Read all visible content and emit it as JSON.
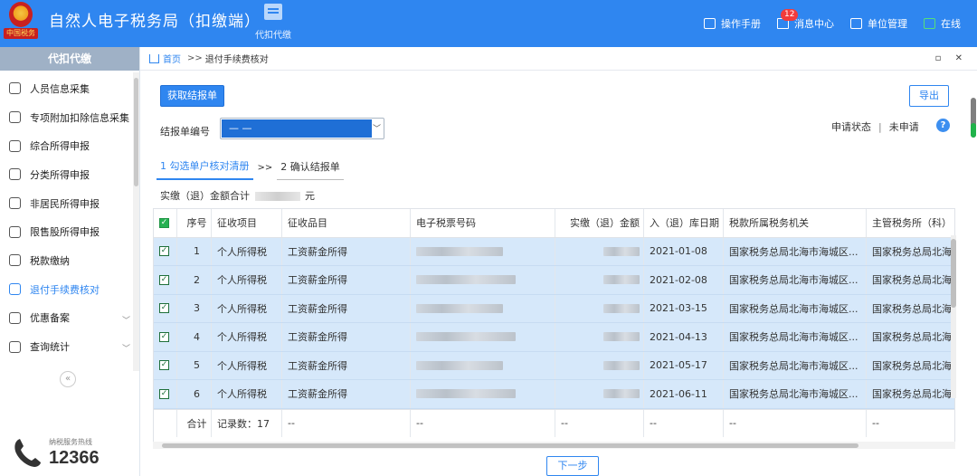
{
  "header": {
    "logo_text": "中国税务",
    "title": "自然人电子税务局（扣缴端）",
    "nav_daikou": "代扣代缴",
    "manual": "操作手册",
    "messages": "消息中心",
    "message_count": "12",
    "unit_mgmt": "单位管理",
    "online": "在线"
  },
  "sidebar": {
    "title": "代扣代缴",
    "items": [
      {
        "label": "人员信息采集",
        "icon": "person-icon"
      },
      {
        "label": "专项附加扣除信息采集",
        "icon": "list-icon"
      },
      {
        "label": "综合所得申报",
        "icon": "layers-icon"
      },
      {
        "label": "分类所得申报",
        "icon": "pie-icon"
      },
      {
        "label": "非居民所得申报",
        "icon": "person-outline-icon"
      },
      {
        "label": "限售股所得申报",
        "icon": "bars-icon"
      },
      {
        "label": "税款缴纳",
        "icon": "wallet-icon"
      },
      {
        "label": "退付手续费核对",
        "icon": "doc-icon"
      },
      {
        "label": "优惠备案",
        "icon": "file-icon"
      },
      {
        "label": "查询统计",
        "icon": "search-list-icon"
      }
    ],
    "hotline_label": "纳税服务热线",
    "hotline_number": "12366"
  },
  "breadcrumb": {
    "home": "首页",
    "sep": ">>",
    "current": "退付手续费核对"
  },
  "toolbar": {
    "get_statement": "获取结报单",
    "export": "导出",
    "statement_no_label": "结报单编号",
    "statement_no_value": "— —",
    "apply_status_label": "申请状态",
    "apply_status_value": "未申请",
    "help": "?"
  },
  "steps": {
    "step1": "1 勾选单户核对清册",
    "sep": ">>",
    "step2": "2 确认结报单"
  },
  "total": {
    "label": "实缴（退）金额合计",
    "unit": "元"
  },
  "table": {
    "headers": [
      "序号",
      "征收项目",
      "征收品目",
      "电子税票号码",
      "实缴（退）金额",
      "入（退）库日期",
      "税款所属税务机关",
      "主管税务所（科）"
    ],
    "rows": [
      {
        "no": "1",
        "item": "个人所得税",
        "sub": "工资薪金所得",
        "date": "2021-01-08",
        "org": "国家税务总局北海市海城区...",
        "office": "国家税务总局北海"
      },
      {
        "no": "2",
        "item": "个人所得税",
        "sub": "工资薪金所得",
        "date": "2021-02-08",
        "org": "国家税务总局北海市海城区...",
        "office": "国家税务总局北海"
      },
      {
        "no": "3",
        "item": "个人所得税",
        "sub": "工资薪金所得",
        "date": "2021-03-15",
        "org": "国家税务总局北海市海城区...",
        "office": "国家税务总局北海"
      },
      {
        "no": "4",
        "item": "个人所得税",
        "sub": "工资薪金所得",
        "date": "2021-04-13",
        "org": "国家税务总局北海市海城区...",
        "office": "国家税务总局北海"
      },
      {
        "no": "5",
        "item": "个人所得税",
        "sub": "工资薪金所得",
        "date": "2021-05-17",
        "org": "国家税务总局北海市海城区...",
        "office": "国家税务总局北海"
      },
      {
        "no": "6",
        "item": "个人所得税",
        "sub": "工资薪金所得",
        "date": "2021-06-11",
        "org": "国家税务总局北海市海城区...",
        "office": "国家税务总局北海"
      }
    ],
    "footer": {
      "label": "合计",
      "count": "记录数：17",
      "dash": "--"
    }
  },
  "next_button": "下一步"
}
